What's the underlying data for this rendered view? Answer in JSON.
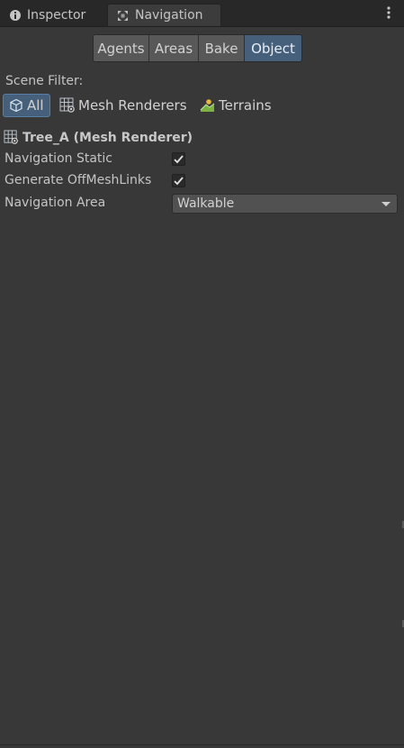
{
  "tabs": [
    {
      "label": "Inspector",
      "icon": "info-icon"
    },
    {
      "label": "Navigation",
      "icon": "navigation-icon"
    }
  ],
  "mode_buttons": [
    "Agents",
    "Areas",
    "Bake",
    "Object"
  ],
  "selected_mode": "Object",
  "scene_filter": {
    "label": "Scene Filter:",
    "options": [
      {
        "label": "All",
        "icon": "cube-icon",
        "selected": true
      },
      {
        "label": "Mesh Renderers",
        "icon": "mesh-renderer-icon",
        "selected": false
      },
      {
        "label": "Terrains",
        "icon": "terrain-icon",
        "selected": false
      }
    ]
  },
  "object": {
    "title": "Tree_A (Mesh Renderer)",
    "icon": "mesh-renderer-icon"
  },
  "properties": {
    "navigation_static": {
      "label": "Navigation Static",
      "checked": true
    },
    "generate_offmeshlinks": {
      "label": "Generate OffMeshLinks",
      "checked": true
    },
    "navigation_area": {
      "label": "Navigation Area",
      "value": "Walkable"
    }
  },
  "colors": {
    "background": "#383838",
    "tab_bar": "#282828",
    "selected_accent": "#46607c",
    "button": "#585858",
    "text": "#c4c4c4"
  }
}
